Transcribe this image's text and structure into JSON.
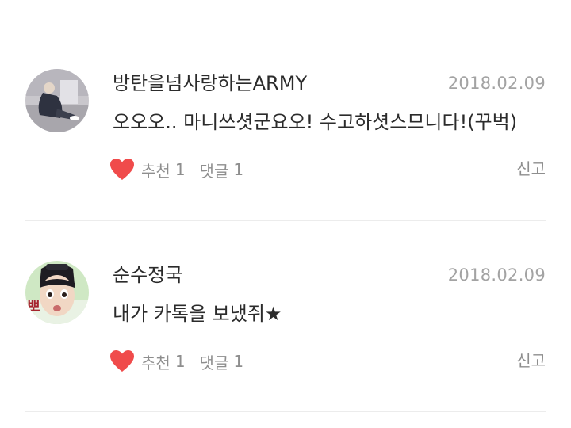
{
  "comments": [
    {
      "nickname": "방탄을넘사랑하는ARMY",
      "date": "2018.02.09",
      "text": "오오오.. 마니쓰셧군요오! 수고하셧스므니다!(꾸벅)",
      "recommend_label": "추천",
      "recommend_count": "1",
      "reply_label": "댓글",
      "reply_count": "1",
      "report_label": "신고"
    },
    {
      "nickname": "순수정국",
      "date": "2018.02.09",
      "text": "내가 카톡을 보냈쥐★",
      "recommend_label": "추천",
      "recommend_count": "1",
      "reply_label": "댓글",
      "reply_count": "1",
      "report_label": "신고",
      "avatar_sticker_text": "뽀"
    }
  ],
  "colors": {
    "heart": "#f04b4b",
    "text": "#2b2b2b",
    "meta": "#a3a3a3",
    "divider": "#ececec"
  },
  "icons": {
    "like": "heart-icon"
  }
}
